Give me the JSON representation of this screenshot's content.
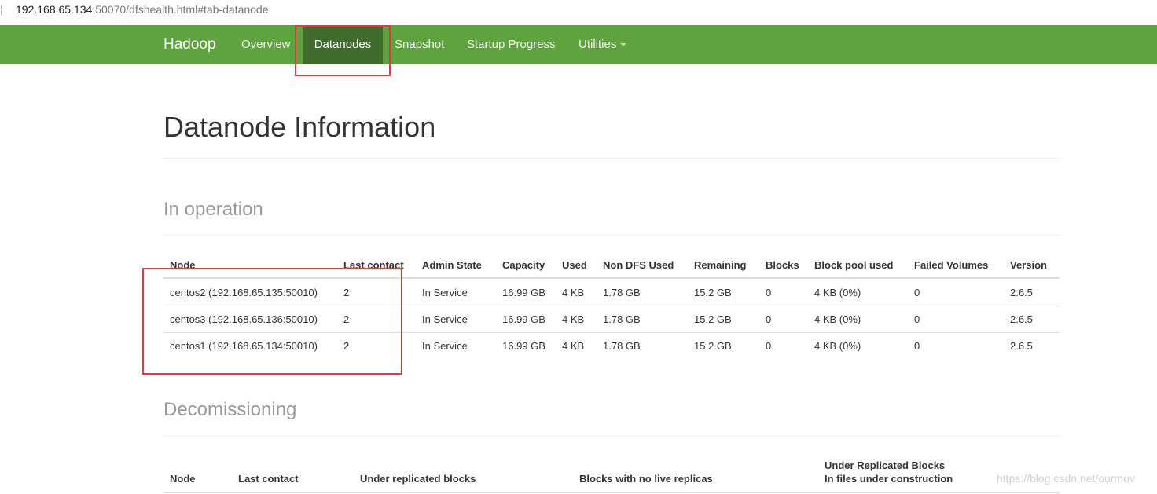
{
  "browser": {
    "address_sep": "¦",
    "host": "192.168.65.134",
    "rest": ":50070/dfshealth.html#tab-datanode"
  },
  "navbar": {
    "brand": "Hadoop",
    "items": [
      {
        "label": "Overview"
      },
      {
        "label": "Datanodes",
        "active": true
      },
      {
        "label": "Snapshot"
      },
      {
        "label": "Startup Progress"
      },
      {
        "label": "Utilities"
      }
    ],
    "bg_color": "#5fa33e",
    "active_color": "#3f6b2b"
  },
  "page": {
    "title": "Datanode Information"
  },
  "in_operation": {
    "title": "In operation",
    "columns": [
      "Node",
      "Last contact",
      "Admin State",
      "Capacity",
      "Used",
      "Non DFS Used",
      "Remaining",
      "Blocks",
      "Block pool used",
      "Failed Volumes",
      "Version"
    ],
    "rows": [
      [
        "centos2 (192.168.65.135:50010)",
        "2",
        "In Service",
        "16.99 GB",
        "4 KB",
        "1.78 GB",
        "15.2 GB",
        "0",
        "4 KB (0%)",
        "0",
        "2.6.5"
      ],
      [
        "centos3 (192.168.65.136:50010)",
        "2",
        "In Service",
        "16.99 GB",
        "4 KB",
        "1.78 GB",
        "15.2 GB",
        "0",
        "4 KB (0%)",
        "0",
        "2.6.5"
      ],
      [
        "centos1 (192.168.65.134:50010)",
        "2",
        "In Service",
        "16.99 GB",
        "4 KB",
        "1.78 GB",
        "15.2 GB",
        "0",
        "4 KB (0%)",
        "0",
        "2.6.5"
      ]
    ]
  },
  "decommissioning": {
    "title": "Decomissioning",
    "columns": [
      "Node",
      "Last contact",
      "Under replicated blocks",
      "Blocks with no live replicas"
    ],
    "last_column_line1": "Under Replicated Blocks",
    "last_column_line2": "In files under construction"
  },
  "highlight_color": "#e0393e",
  "watermark": "https://blog.csdn.net/ourmuv"
}
